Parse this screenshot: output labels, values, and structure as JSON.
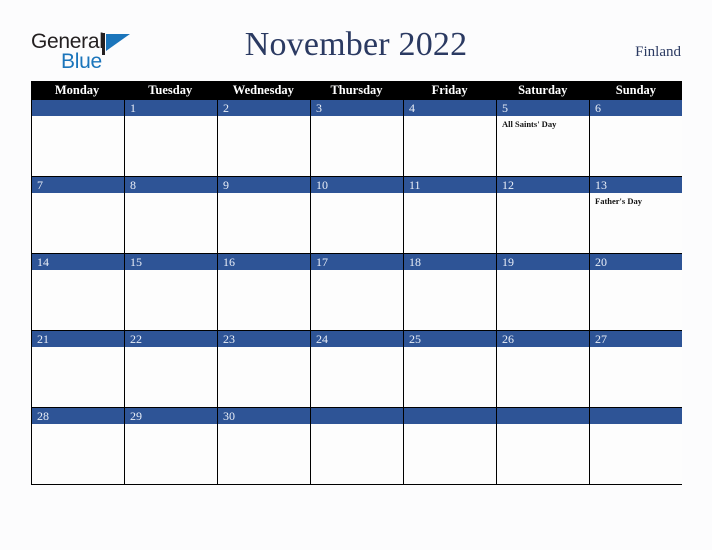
{
  "brand": {
    "name_part1": "General",
    "name_part2": "Blue",
    "mark_icon": "triangle-flag-icon",
    "color_dark": "#231f20",
    "color_blue": "#1b75bb"
  },
  "header": {
    "title": "November 2022",
    "country": "Finland",
    "title_color": "#2b3a62"
  },
  "calendar": {
    "accent_color": "#2e5496",
    "header_bg": "#000000",
    "weekdays": [
      "Monday",
      "Tuesday",
      "Wednesday",
      "Thursday",
      "Friday",
      "Saturday",
      "Sunday"
    ],
    "weeks": [
      [
        {
          "day": "",
          "event": ""
        },
        {
          "day": "1",
          "event": ""
        },
        {
          "day": "2",
          "event": ""
        },
        {
          "day": "3",
          "event": ""
        },
        {
          "day": "4",
          "event": ""
        },
        {
          "day": "5",
          "event": "All Saints' Day"
        },
        {
          "day": "6",
          "event": ""
        }
      ],
      [
        {
          "day": "7",
          "event": ""
        },
        {
          "day": "8",
          "event": ""
        },
        {
          "day": "9",
          "event": ""
        },
        {
          "day": "10",
          "event": ""
        },
        {
          "day": "11",
          "event": ""
        },
        {
          "day": "12",
          "event": ""
        },
        {
          "day": "13",
          "event": "Father's Day"
        }
      ],
      [
        {
          "day": "14",
          "event": ""
        },
        {
          "day": "15",
          "event": ""
        },
        {
          "day": "16",
          "event": ""
        },
        {
          "day": "17",
          "event": ""
        },
        {
          "day": "18",
          "event": ""
        },
        {
          "day": "19",
          "event": ""
        },
        {
          "day": "20",
          "event": ""
        }
      ],
      [
        {
          "day": "21",
          "event": ""
        },
        {
          "day": "22",
          "event": ""
        },
        {
          "day": "23",
          "event": ""
        },
        {
          "day": "24",
          "event": ""
        },
        {
          "day": "25",
          "event": ""
        },
        {
          "day": "26",
          "event": ""
        },
        {
          "day": "27",
          "event": ""
        }
      ],
      [
        {
          "day": "28",
          "event": ""
        },
        {
          "day": "29",
          "event": ""
        },
        {
          "day": "30",
          "event": ""
        },
        {
          "day": "",
          "event": ""
        },
        {
          "day": "",
          "event": ""
        },
        {
          "day": "",
          "event": ""
        },
        {
          "day": "",
          "event": ""
        }
      ]
    ]
  }
}
